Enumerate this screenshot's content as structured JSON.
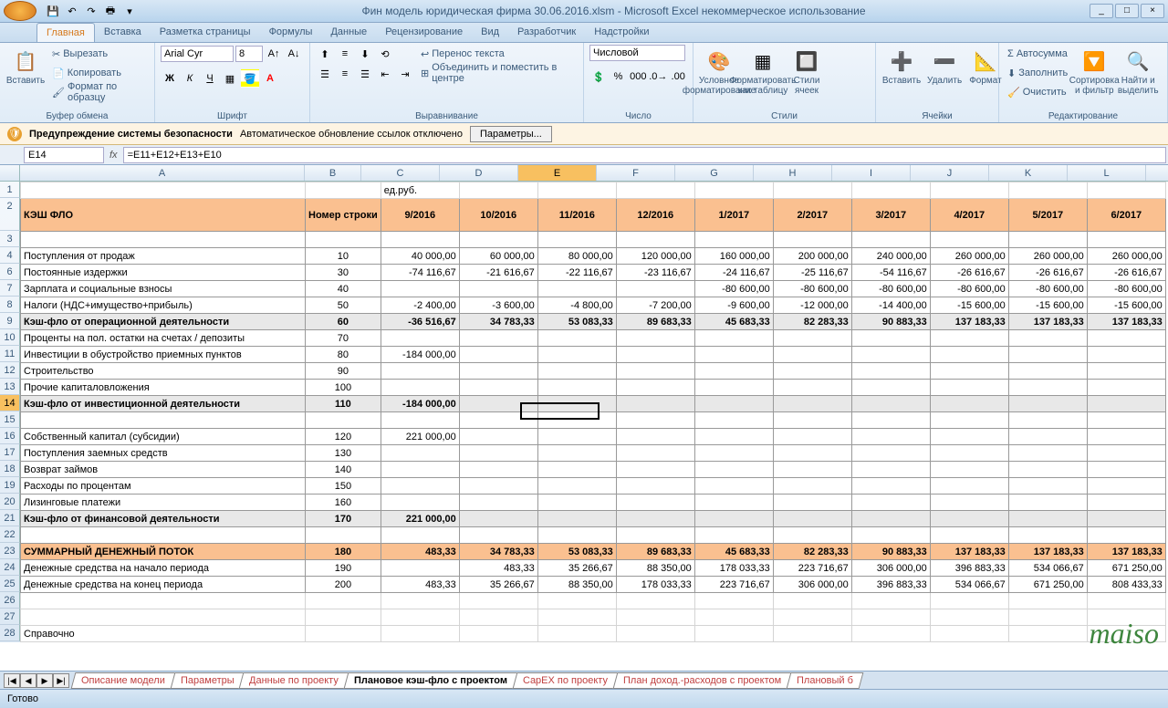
{
  "title": "Фин модель юридическая фирма 30.06.2016.xlsm - Microsoft Excel некоммерческое использование",
  "ribbon_tabs": [
    "Главная",
    "Вставка",
    "Разметка страницы",
    "Формулы",
    "Данные",
    "Рецензирование",
    "Вид",
    "Разработчик",
    "Надстройки"
  ],
  "ribbon": {
    "clipboard": {
      "label": "Буфер обмена",
      "paste": "Вставить",
      "cut": "Вырезать",
      "copy": "Копировать",
      "format_painter": "Формат по образцу"
    },
    "font": {
      "label": "Шрифт",
      "name": "Arial Cyr",
      "size": "8"
    },
    "alignment": {
      "label": "Выравнивание",
      "wrap": "Перенос текста",
      "merge": "Объединить и поместить в центре"
    },
    "number": {
      "label": "Число",
      "format": "Числовой"
    },
    "styles": {
      "label": "Стили",
      "cond": "Условное форматирование",
      "table": "Форматировать как таблицу",
      "cell": "Стили ячеек"
    },
    "cells": {
      "label": "Ячейки",
      "insert": "Вставить",
      "delete": "Удалить",
      "format": "Формат"
    },
    "editing": {
      "label": "Редактирование",
      "sum": "Автосумма",
      "fill": "Заполнить",
      "clear": "Очистить",
      "sort": "Сортировка и фильтр",
      "find": "Найти и выделить"
    }
  },
  "security": {
    "title": "Предупреждение системы безопасности",
    "msg": "Автоматическое обновление ссылок отключено",
    "btn": "Параметры..."
  },
  "name_box": "E14",
  "formula": "=E11+E12+E13+E10",
  "columns": [
    "A",
    "B",
    "C",
    "D",
    "E",
    "F",
    "G",
    "H",
    "I",
    "J",
    "K",
    "L"
  ],
  "col_headers_row": [
    "КЭШ ФЛО",
    "Номер строки",
    "9/2016",
    "10/2016",
    "11/2016",
    "12/2016",
    "1/2017",
    "2/2017",
    "3/2017",
    "4/2017",
    "5/2017",
    "6/2017"
  ],
  "unit": "ед.руб.",
  "rows": [
    {
      "n": 4,
      "label": "Поступления от продаж",
      "num": "10",
      "vals": [
        "40 000,00",
        "60 000,00",
        "80 000,00",
        "120 000,00",
        "160 000,00",
        "200 000,00",
        "240 000,00",
        "260 000,00",
        "260 000,00",
        "260 000,00"
      ]
    },
    {
      "n": 6,
      "label": "Постоянные издержки",
      "num": "30",
      "vals": [
        "-74 116,67",
        "-21 616,67",
        "-22 116,67",
        "-23 116,67",
        "-24 116,67",
        "-25 116,67",
        "-54 116,67",
        "-26 616,67",
        "-26 616,67",
        "-26 616,67"
      ]
    },
    {
      "n": 7,
      "label": "Зарплата и социальные взносы",
      "num": "40",
      "vals": [
        "",
        "",
        "",
        "",
        "-80 600,00",
        "-80 600,00",
        "-80 600,00",
        "-80 600,00",
        "-80 600,00",
        "-80 600,00"
      ]
    },
    {
      "n": 8,
      "label": "Налоги (НДС+имущество+прибыль)",
      "num": "50",
      "vals": [
        "-2 400,00",
        "-3 600,00",
        "-4 800,00",
        "-7 200,00",
        "-9 600,00",
        "-12 000,00",
        "-14 400,00",
        "-15 600,00",
        "-15 600,00",
        "-15 600,00"
      ]
    },
    {
      "n": 9,
      "label": "Кэш-фло от операционной деятельности",
      "num": "60",
      "vals": [
        "-36 516,67",
        "34 783,33",
        "53 083,33",
        "89 683,33",
        "45 683,33",
        "82 283,33",
        "90 883,33",
        "137 183,33",
        "137 183,33",
        "137 183,33"
      ],
      "cls": "sub-row"
    },
    {
      "n": 10,
      "label": "Проценты на пол. остатки на счетах / депозиты",
      "num": "70",
      "vals": [
        "",
        "",
        "",
        "",
        "",
        "",
        "",
        "",
        "",
        ""
      ]
    },
    {
      "n": 11,
      "label": "Инвестиции в обустройство приемных пунктов",
      "num": "80",
      "vals": [
        "-184 000,00",
        "",
        "",
        "",
        "",
        "",
        "",
        "",
        "",
        ""
      ]
    },
    {
      "n": 12,
      "label": "Строительство",
      "num": "90",
      "vals": [
        "",
        "",
        "",
        "",
        "",
        "",
        "",
        "",
        "",
        ""
      ]
    },
    {
      "n": 13,
      "label": "Прочие капиталовложения",
      "num": "100",
      "vals": [
        "",
        "",
        "",
        "",
        "",
        "",
        "",
        "",
        "",
        ""
      ]
    },
    {
      "n": 14,
      "label": "Кэш-фло от инвестиционной деятельности",
      "num": "110",
      "vals": [
        "-184 000,00",
        "",
        "",
        "",
        "",
        "",
        "",
        "",
        "",
        ""
      ],
      "cls": "sub-row"
    },
    {
      "n": 15,
      "label": "",
      "num": "",
      "vals": [
        "",
        "",
        "",
        "",
        "",
        "",
        "",
        "",
        "",
        ""
      ]
    },
    {
      "n": 16,
      "label": "Собственный капитал (субсидии)",
      "num": "120",
      "vals": [
        "221 000,00",
        "",
        "",
        "",
        "",
        "",
        "",
        "",
        "",
        ""
      ]
    },
    {
      "n": 17,
      "label": "Поступления заемных средств",
      "num": "130",
      "vals": [
        "",
        "",
        "",
        "",
        "",
        "",
        "",
        "",
        "",
        ""
      ]
    },
    {
      "n": 18,
      "label": "Возврат займов",
      "num": "140",
      "vals": [
        "",
        "",
        "",
        "",
        "",
        "",
        "",
        "",
        "",
        ""
      ]
    },
    {
      "n": 19,
      "label": "Расходы по процентам",
      "num": "150",
      "vals": [
        "",
        "",
        "",
        "",
        "",
        "",
        "",
        "",
        "",
        ""
      ]
    },
    {
      "n": 20,
      "label": "Лизинговые платежи",
      "num": "160",
      "vals": [
        "",
        "",
        "",
        "",
        "",
        "",
        "",
        "",
        "",
        ""
      ]
    },
    {
      "n": 21,
      "label": "Кэш-фло от финансовой деятельности",
      "num": "170",
      "vals": [
        "221 000,00",
        "",
        "",
        "",
        "",
        "",
        "",
        "",
        "",
        ""
      ],
      "cls": "sub-row"
    },
    {
      "n": 22,
      "label": "",
      "num": "",
      "vals": [
        "",
        "",
        "",
        "",
        "",
        "",
        "",
        "",
        "",
        ""
      ]
    },
    {
      "n": 23,
      "label": "СУММАРНЫЙ ДЕНЕЖНЫЙ ПОТОК",
      "num": "180",
      "vals": [
        "483,33",
        "34 783,33",
        "53 083,33",
        "89 683,33",
        "45 683,33",
        "82 283,33",
        "90 883,33",
        "137 183,33",
        "137 183,33",
        "137 183,33"
      ],
      "cls": "sum-row"
    },
    {
      "n": 24,
      "label": "Денежные средства на начало периода",
      "num": "190",
      "vals": [
        "",
        "483,33",
        "35 266,67",
        "88 350,00",
        "178 033,33",
        "223 716,67",
        "306 000,00",
        "396 883,33",
        "534 066,67",
        "671 250,00"
      ]
    },
    {
      "n": 25,
      "label": "Денежные средства на конец периода",
      "num": "200",
      "vals": [
        "483,33",
        "35 266,67",
        "88 350,00",
        "178 033,33",
        "223 716,67",
        "306 000,00",
        "396 883,33",
        "534 066,67",
        "671 250,00",
        "808 433,33"
      ]
    },
    {
      "n": 26,
      "label": "",
      "num": "",
      "vals": [
        "",
        "",
        "",
        "",
        "",
        "",
        "",
        "",
        "",
        ""
      ],
      "noborder": true
    },
    {
      "n": 27,
      "label": "",
      "num": "",
      "vals": [
        "",
        "",
        "",
        "",
        "",
        "",
        "",
        "",
        "",
        ""
      ],
      "noborder": true
    },
    {
      "n": 28,
      "label": "Справочно",
      "num": "",
      "vals": [
        "",
        "",
        "",
        "",
        "",
        "",
        "",
        "",
        "",
        ""
      ],
      "noborder": true
    }
  ],
  "sheet_tabs": [
    "Описание модели",
    "Параметры",
    "Данные по проекту",
    "Плановое кэш-фло с проектом",
    "CapEX по проекту",
    "План доход.-расходов с проектом",
    "Плановый б"
  ],
  "active_sheet": 3,
  "status": "Готово",
  "watermark": "maiso"
}
